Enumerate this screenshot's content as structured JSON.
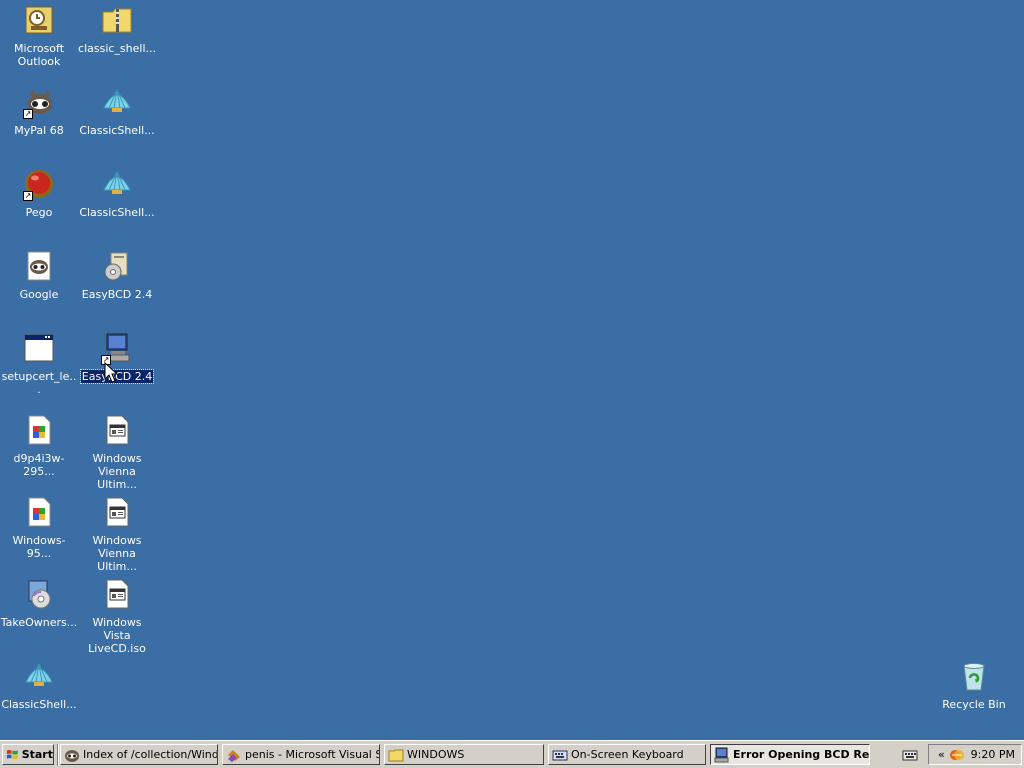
{
  "desktop": {
    "icons": [
      {
        "label": "Microsoft Outlook",
        "icon": "outlook-icon"
      },
      {
        "label": "classic_shell...",
        "icon": "zip-folder-icon"
      },
      {
        "label": "MyPal 68",
        "icon": "mypal-raccoon-icon"
      },
      {
        "label": "ClassicShell...",
        "icon": "shell-icon"
      },
      {
        "label": "Pego",
        "icon": "pego-red-ball-icon"
      },
      {
        "label": "ClassicShell...",
        "icon": "shell-icon"
      },
      {
        "label": "Google",
        "icon": "raccoon-document-icon"
      },
      {
        "label": "EasyBCD 2.4",
        "icon": "installer-icon"
      },
      {
        "label": "setupcert_le...",
        "icon": "application-window-icon"
      },
      {
        "label": "EasyBCD 2.4",
        "icon": "computer-shortcut-icon"
      },
      {
        "label": "d9p4i3w-295...",
        "icon": "image-file-icon"
      },
      {
        "label": "Windows Vienna Ultim...",
        "icon": "iso-file-icon"
      },
      {
        "label": "Windows-95...",
        "icon": "image-file-icon"
      },
      {
        "label": "Windows Vienna Ultim...",
        "icon": "iso-file-icon"
      },
      {
        "label": "TakeOwners...",
        "icon": "installer-cd-icon"
      },
      {
        "label": "Windows Vista LiveCD.iso",
        "icon": "iso-file-icon"
      },
      {
        "label": "ClassicShell...",
        "icon": "shell-icon"
      },
      {
        "label": "Recycle Bin",
        "icon": "recycle-bin-icon"
      }
    ]
  },
  "taskbar": {
    "start_label": "Start",
    "tasks": [
      {
        "label": "Index of /collection/Wind...",
        "icon": "browser-icon"
      },
      {
        "label": "penis - Microsoft Visual S...",
        "icon": "visual-studio-icon"
      },
      {
        "label": "WINDOWS",
        "icon": "folder-icon"
      },
      {
        "label": "On-Screen Keyboard",
        "icon": "keyboard-icon"
      },
      {
        "label": "Error Opening BCD Re...",
        "icon": "error-app-icon"
      }
    ],
    "clock": "9:20 PM",
    "tray_chevron": "«"
  },
  "colors": {
    "desktop_background": "#3A6EA5",
    "taskbar_face": "#D4D0C8",
    "selection": "#0A246A"
  }
}
